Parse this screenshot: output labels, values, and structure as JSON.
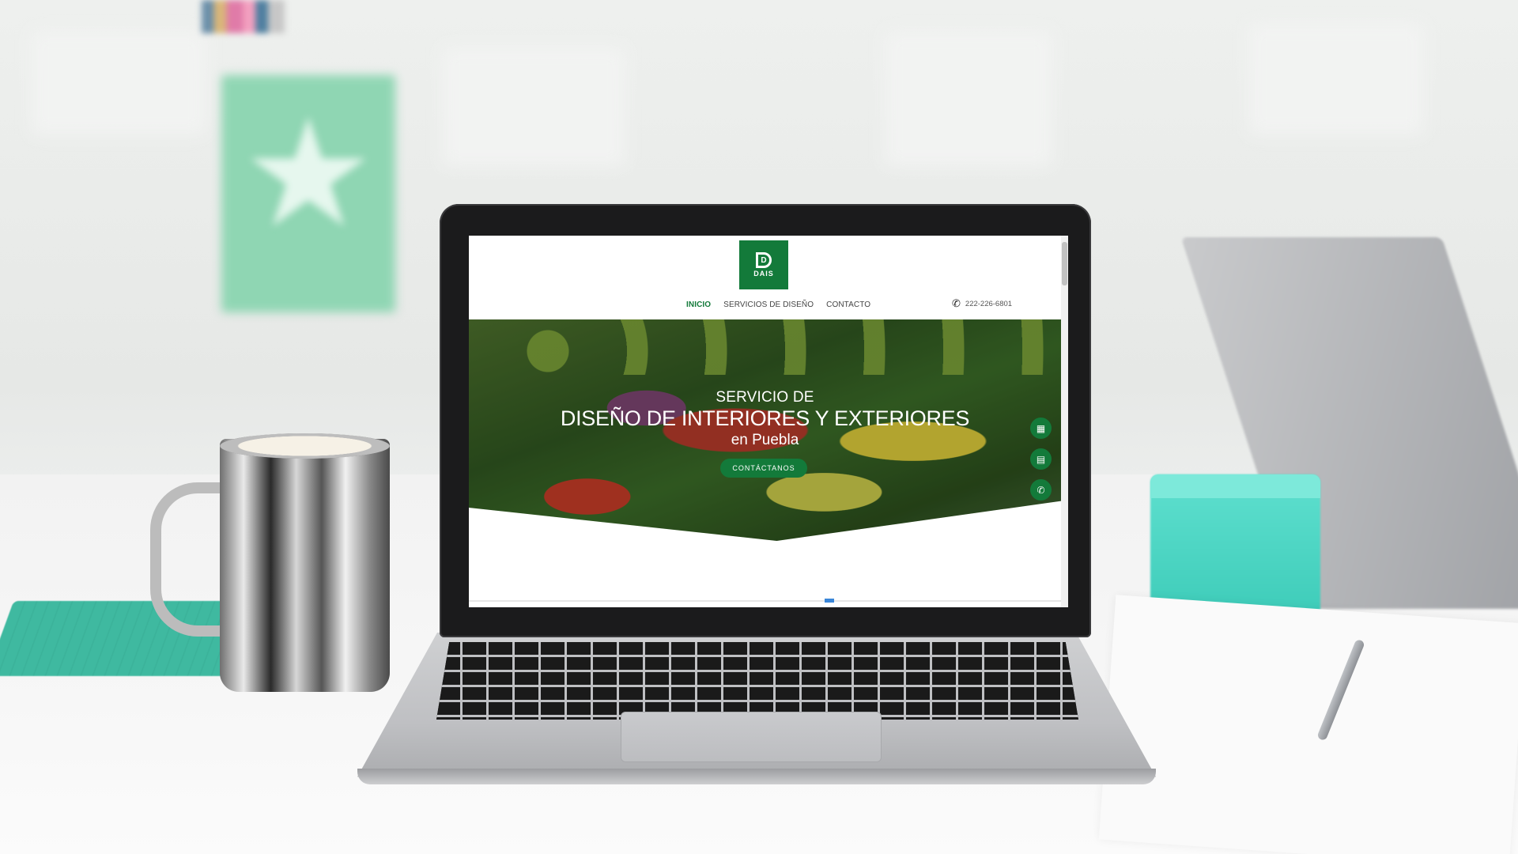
{
  "colors": {
    "brand_green": "#137a3a",
    "nav_active": "#137a3a",
    "text_dark": "#444444",
    "scroll_indicator": "#3a86d8"
  },
  "site": {
    "logo_text": "DAIS",
    "nav": [
      {
        "label": "INICIO",
        "active": true
      },
      {
        "label": "SERVICIOS DE DISEÑO",
        "active": false
      },
      {
        "label": "CONTACTO",
        "active": false
      }
    ],
    "phone_icon": "phone-icon",
    "phone_number": "222-226-6801",
    "hero": {
      "title_line1": "SERVICIO DE",
      "title_line2": "DISEÑO DE INTERIORES Y EXTERIORES",
      "title_line3": "en Puebla",
      "cta_label": "CONTÁCTANOS"
    },
    "floating_buttons": [
      {
        "icon": "calendar-icon",
        "glyph": "▦"
      },
      {
        "icon": "document-icon",
        "glyph": "▤"
      },
      {
        "icon": "phone-icon",
        "glyph": "✆"
      },
      {
        "icon": "whatsapp-icon",
        "glyph": "◎"
      }
    ]
  }
}
